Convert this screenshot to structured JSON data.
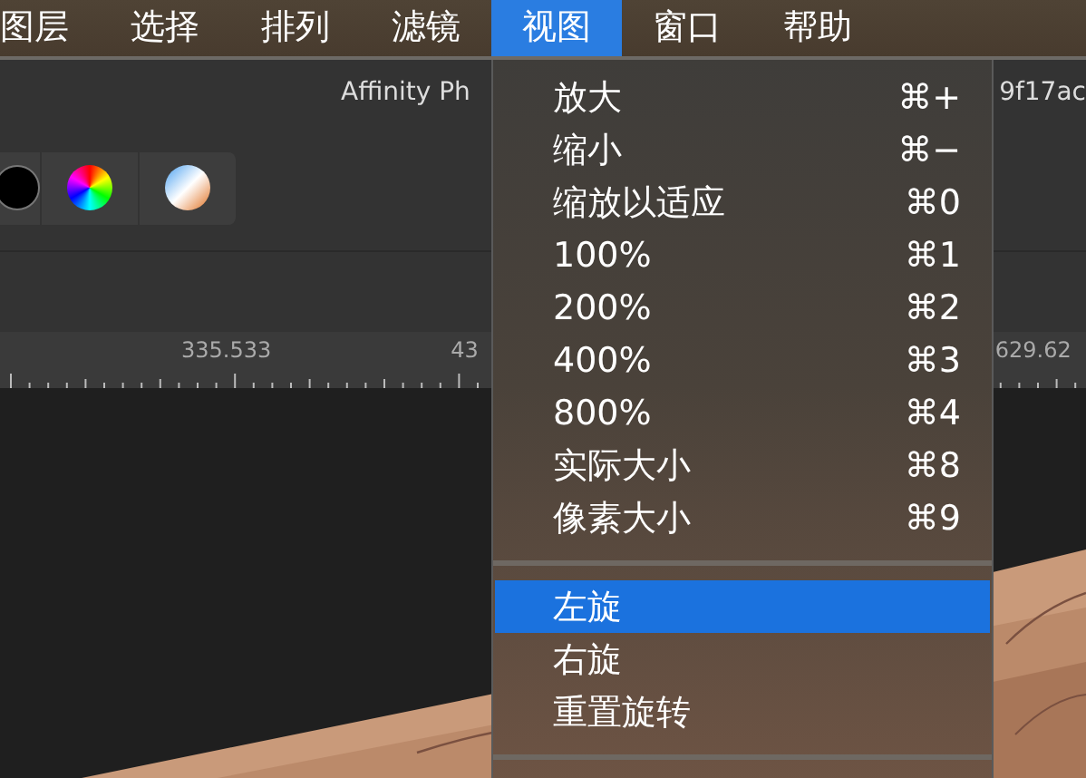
{
  "menu_bar": {
    "items": [
      {
        "label": "图层",
        "selected": false
      },
      {
        "label": "选择",
        "selected": false
      },
      {
        "label": "排列",
        "selected": false
      },
      {
        "label": "滤镜",
        "selected": false
      },
      {
        "label": "视图",
        "selected": true
      },
      {
        "label": "窗口",
        "selected": false
      },
      {
        "label": "帮助",
        "selected": false
      }
    ]
  },
  "title_bar": {
    "texts": [
      "Affinity Ph",
      "9f17ac"
    ]
  },
  "toolbar": {
    "swatches": [
      {
        "kind": "black"
      },
      {
        "kind": "wheel"
      },
      {
        "kind": "gradient"
      }
    ]
  },
  "ruler": {
    "labels": [
      "335.533",
      "43",
      "629.62"
    ]
  },
  "menu": {
    "items": [
      {
        "kind": "item",
        "label": "放大",
        "shortcut": "⌘+",
        "selected": false
      },
      {
        "kind": "item",
        "label": "缩小",
        "shortcut": "⌘−",
        "selected": false
      },
      {
        "kind": "item",
        "label": "缩放以适应",
        "shortcut": "⌘0",
        "selected": false
      },
      {
        "kind": "item",
        "label": "100%",
        "shortcut": "⌘1",
        "selected": false
      },
      {
        "kind": "item",
        "label": "200%",
        "shortcut": "⌘2",
        "selected": false
      },
      {
        "kind": "item",
        "label": "400%",
        "shortcut": "⌘3",
        "selected": false
      },
      {
        "kind": "item",
        "label": "800%",
        "shortcut": "⌘4",
        "selected": false
      },
      {
        "kind": "item",
        "label": "实际大小",
        "shortcut": "⌘8",
        "selected": false
      },
      {
        "kind": "item",
        "label": "像素大小",
        "shortcut": "⌘9",
        "selected": false
      },
      {
        "kind": "separator"
      },
      {
        "kind": "item",
        "label": "左旋",
        "selected": true
      },
      {
        "kind": "item",
        "label": "右旋",
        "selected": false
      },
      {
        "kind": "item",
        "label": "重置旋转",
        "selected": false
      },
      {
        "kind": "separator"
      }
    ]
  }
}
